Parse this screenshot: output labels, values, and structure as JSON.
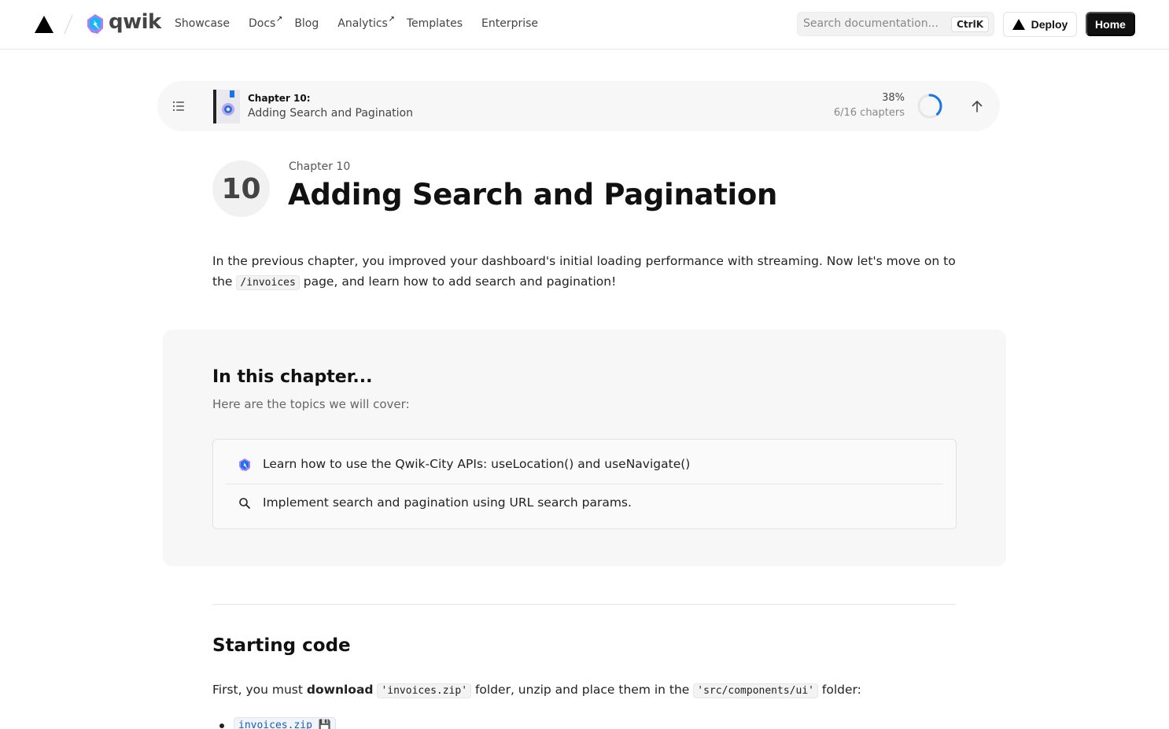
{
  "nav": {
    "brand": "qwik",
    "links": [
      {
        "label": "Showcase",
        "external": false
      },
      {
        "label": "Docs",
        "external": true
      },
      {
        "label": "Blog",
        "external": false
      },
      {
        "label": "Analytics",
        "external": true
      },
      {
        "label": "Templates",
        "external": false
      },
      {
        "label": "Enterprise",
        "external": false
      }
    ],
    "search_placeholder": "Search documentation...",
    "search_shortcut": "CtrlK",
    "deploy_label": "Deploy",
    "home_label": "Home",
    "external_glyph": "↗"
  },
  "chapter_bar": {
    "label": "Chapter 10:",
    "title": "Adding Search and Pagination",
    "percent": "38%",
    "progress_value": 0.38,
    "count": "6/16 chapters"
  },
  "header": {
    "number": "10",
    "kicker": "Chapter 10",
    "title": "Adding Search and Pagination"
  },
  "intro": {
    "before": "In the previous chapter, you improved your dashboard's initial loading performance with streaming. Now let's move on to the ",
    "code": "/invoices",
    "after": " page, and learn how to add search and pagination!"
  },
  "in_this_chapter": {
    "title": "In this chapter...",
    "subtitle": "Here are the topics we will cover:",
    "topics": [
      {
        "icon": "qwik-logo-icon",
        "text": "Learn how to use the Qwik-City APIs: useLocation() and useNavigate()"
      },
      {
        "icon": "search-icon",
        "text": "Implement search and pagination using URL search params."
      }
    ]
  },
  "starting_code": {
    "heading": "Starting code",
    "p_before": "First, you must ",
    "p_bold": "download",
    "p_code1": "'invoices.zip'",
    "p_mid": " folder, unzip and place them in the ",
    "p_code2": "'src/components/ui'",
    "p_after": " folder:",
    "download_link": "invoices.zip 💾"
  },
  "colors": {
    "accent_blue": "#1a73e8",
    "qwik_blue": "#18b6f6",
    "qwik_purple": "#ac7ef4",
    "text_dark": "#111111",
    "card_bg": "#f7f7f7"
  }
}
